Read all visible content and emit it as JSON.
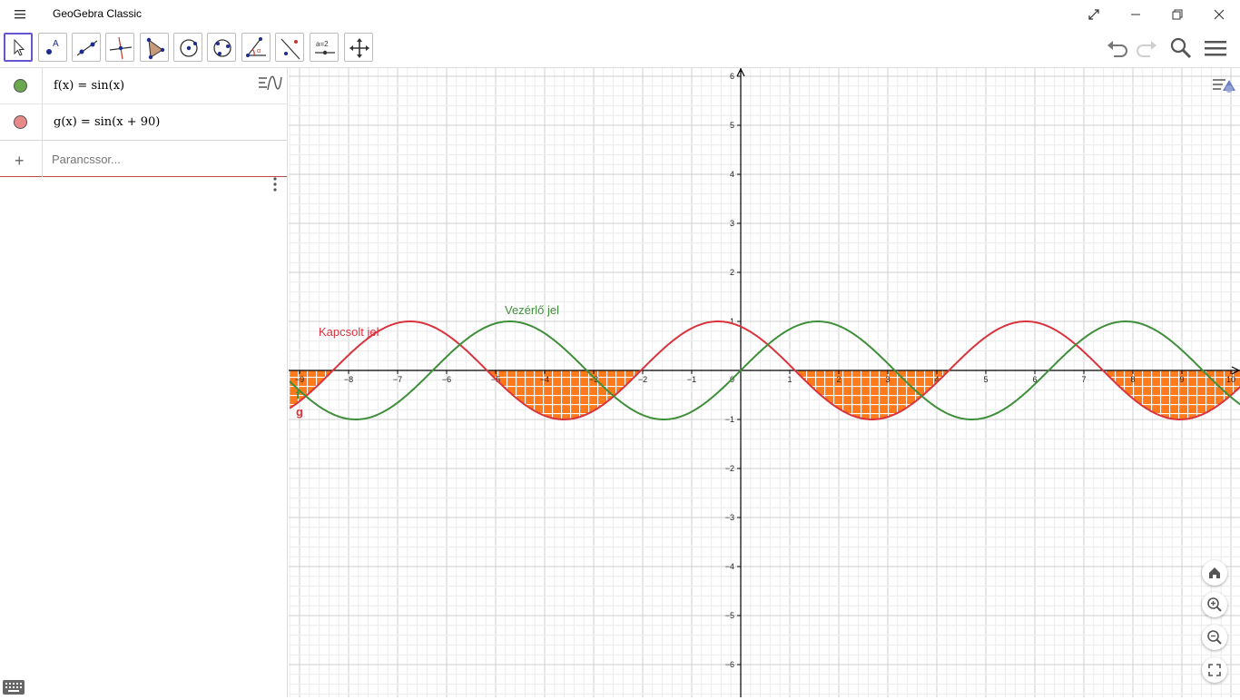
{
  "window": {
    "title": "GeoGebra Classic"
  },
  "toolbar": {
    "tools": [
      {
        "icon": "move-icon"
      },
      {
        "icon": "point-icon"
      },
      {
        "icon": "line-icon"
      },
      {
        "icon": "perpendicular-line-icon"
      },
      {
        "icon": "polygon-icon"
      },
      {
        "icon": "circle-center-point-icon"
      },
      {
        "icon": "circle-three-points-icon"
      },
      {
        "icon": "angle-icon"
      },
      {
        "icon": "reflect-icon"
      },
      {
        "icon": "slider-icon",
        "label": "a=2"
      },
      {
        "icon": "move-graphics-icon"
      }
    ],
    "right": [
      "undo-icon",
      "redo-icon",
      "search-icon",
      "menu-icon"
    ]
  },
  "algebra": {
    "rows": [
      {
        "label": "f(x)  =  sin(x)",
        "color": "#6aa84f"
      },
      {
        "label": "g(x)  =  sin(x + 90)",
        "color": "#e06666"
      }
    ],
    "input_placeholder": "Parancssor..."
  },
  "graphics": {
    "texts": {
      "f_name": "f",
      "g_name": "g",
      "f_caption": "Vezérlő jel",
      "g_caption": "Kapcsolt jel"
    },
    "colors": {
      "f": "#3f8f3a",
      "g": "#d9343e",
      "fill": "#ff7a1a",
      "axis": "#000000",
      "major_grid": "#cfcfcf",
      "minor_grid": "#ececec"
    },
    "x_ticks": [
      "-9",
      "-8",
      "-7",
      "-6",
      "-5",
      "-4",
      "-3",
      "-2",
      "-1",
      "0",
      "1",
      "2",
      "3",
      "4",
      "5",
      "6",
      "7",
      "8",
      "9",
      "10"
    ],
    "y_ticks": [
      "6",
      "5",
      "4",
      "3",
      "2",
      "1",
      "-1",
      "-2",
      "-3",
      "-4",
      "-5",
      "-6"
    ]
  },
  "chart_data": {
    "type": "line",
    "x_range": [
      -9.2,
      10.2
    ],
    "y_range": [
      -6.5,
      6.2
    ],
    "grid": true,
    "series": [
      {
        "name": "f",
        "expression": "sin(x)"
      },
      {
        "name": "g",
        "expression": "sin(x + 90)"
      }
    ],
    "filled_region": "between g and the x-axis where g < 0"
  }
}
